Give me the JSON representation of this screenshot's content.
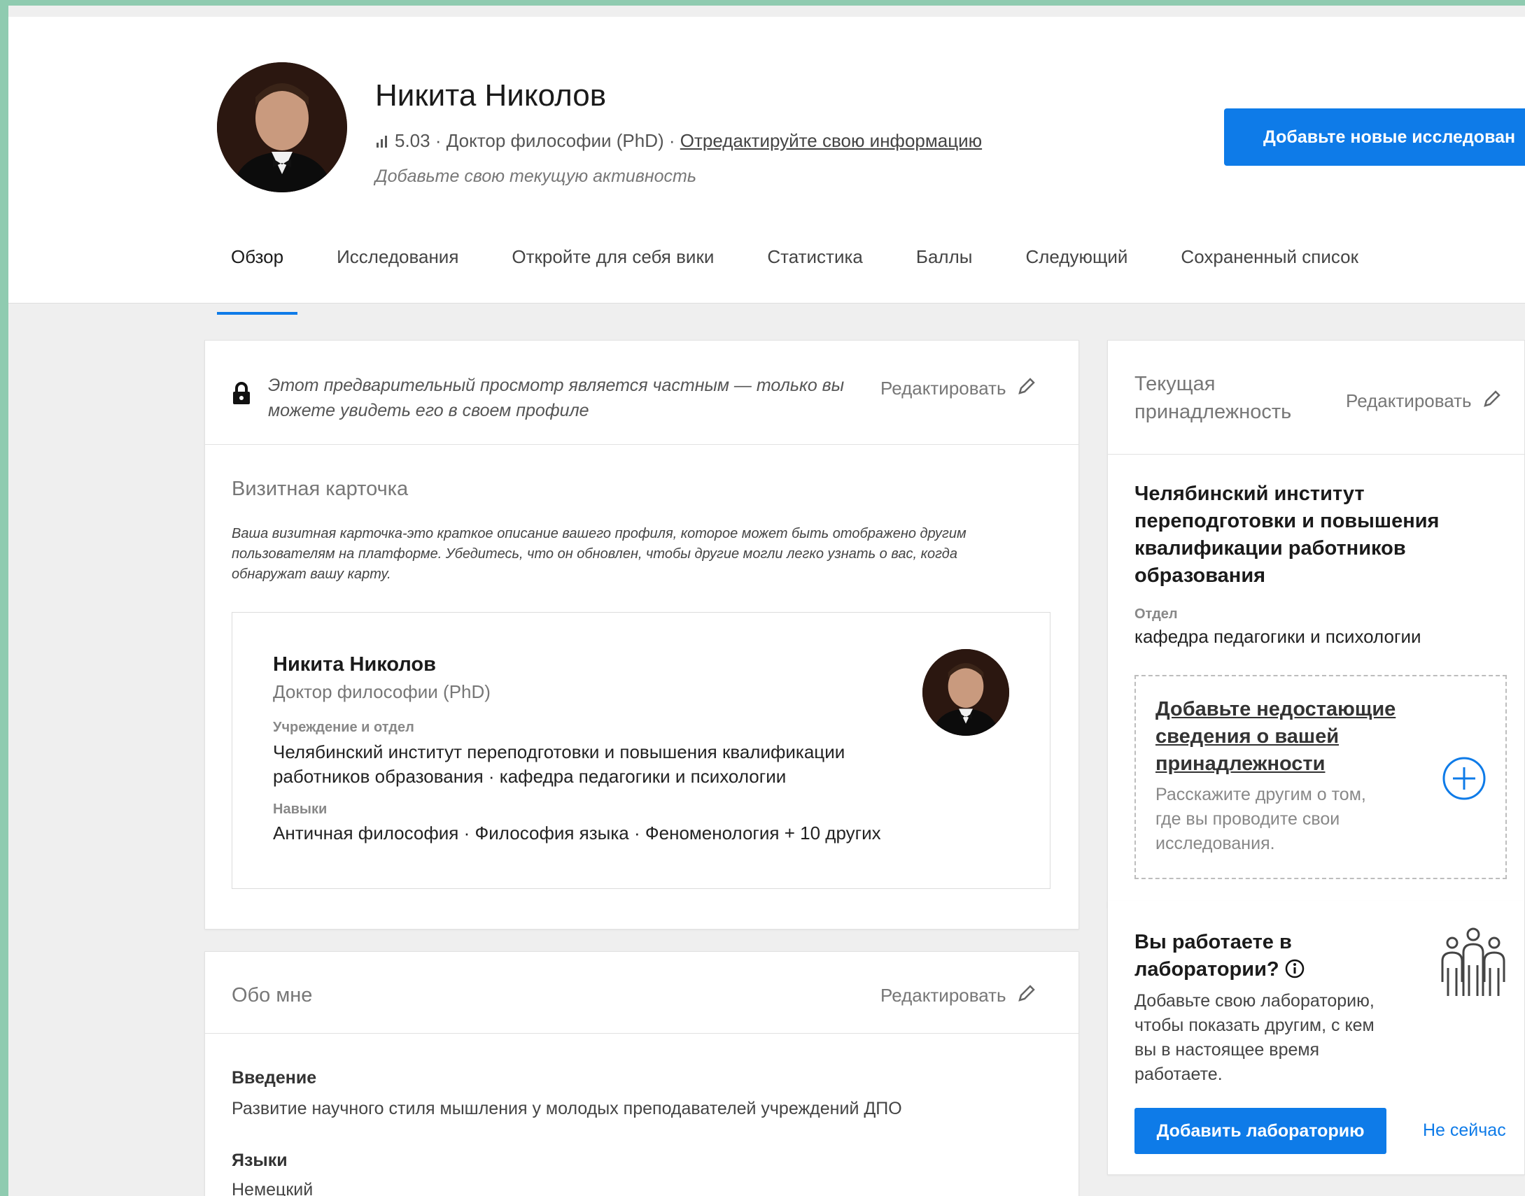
{
  "profile": {
    "name": "Никита Николов",
    "score": "5.03",
    "degree": "Доктор философии (PhD)",
    "edit_info_link": "Отредактируйте свою информацию",
    "activity_placeholder": "Добавьте свою текущую активность",
    "add_research_button": "Добавьте новые исследован"
  },
  "tabs": [
    "Обзор",
    "Исследования",
    "Откройте для себя вики",
    "Статистика",
    "Баллы",
    "Следующий",
    "Сохраненный список"
  ],
  "private_notice": {
    "text_line1": "Этот предварительный просмотр является частным — только вы",
    "text_line2": "можете увидеть его в своем профиле",
    "edit_label": "Редактировать"
  },
  "business_card": {
    "title": "Визитная карточка",
    "description_line1": "Ваша визитная карточка-это краткое описание вашего профиля, которое может быть отображено другим",
    "description_line2": "пользователям на платформе. Убедитесь, что он обновлен, чтобы другие могли легко узнать о вас, когда",
    "description_line3": "обнаружат вашу карту.",
    "name": "Никита Николов",
    "degree": "Доктор философии (PhD)",
    "institution_label": "Учреждение и отдел",
    "institution_line1": "Челябинский институт переподготовки и повышения квалификации",
    "institution_line2": "работников образования · кафедра педагогики и психологии",
    "skills_label": "Навыки",
    "skills": "Античная философия · Философия языка · Феноменология + 10 других"
  },
  "about": {
    "title": "Обо мне",
    "edit_label": "Редактировать",
    "intro_label": "Введение",
    "intro_text": "Развитие научного стиля мышления у молодых преподавателей учреждений ДПО",
    "languages_label": "Языки",
    "languages_text": "Немецкий"
  },
  "affiliation": {
    "title_line1": "Текущая",
    "title_line2": "принадлежность",
    "edit_label": "Редактировать",
    "org_line1": "Челябинский институт",
    "org_line2": "переподготовки и повышения",
    "org_line3": "квалификации работников",
    "org_line4": "образования",
    "dept_label": "Отдел",
    "dept_value": "кафедра педагогики и психологии",
    "add_missing_line1": "Добавьте недостающие",
    "add_missing_line2": "сведения о вашей",
    "add_missing_line3": "принадлежности",
    "add_missing_desc_line1": "Расскажите другим о том,",
    "add_missing_desc_line2": "где вы проводите свои",
    "add_missing_desc_line3": "исследования."
  },
  "lab": {
    "title_line1": "Вы работаете в",
    "title_line2": "лаборатории?",
    "desc_line1": "Добавьте свою лабораторию,",
    "desc_line2": "чтобы показать другим, с кем",
    "desc_line3": "вы в настоящее время",
    "desc_line4": "работаете.",
    "add_button": "Добавить лабораторию",
    "not_now": "Не сейчас"
  },
  "colors": {
    "accent": "#0e7be8",
    "page_bg": "#efefef",
    "frame": "#8fcbb0"
  }
}
